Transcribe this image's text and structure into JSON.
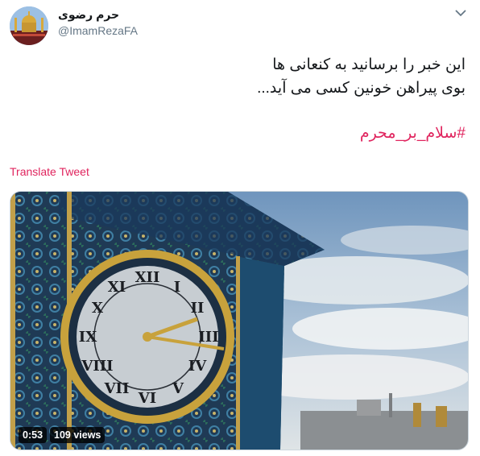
{
  "author": {
    "name": "حرم رضوی",
    "handle": "@ImamRezaFA"
  },
  "tweet": {
    "lines": [
      "این خبر را برسانید به کنعانی ها",
      "بوی پیراهن خونین کسی می آید..."
    ],
    "hashtag": "#سلام_بر_محرم",
    "translate_label": "Translate Tweet"
  },
  "media": {
    "duration": "0:53",
    "views": "109 views"
  },
  "icons": {
    "menu": "chevron-down-icon",
    "avatar": "shrine-photo"
  },
  "colors": {
    "accent": "#e0245e",
    "secondary_text": "#657786",
    "primary_text": "#14171a"
  }
}
